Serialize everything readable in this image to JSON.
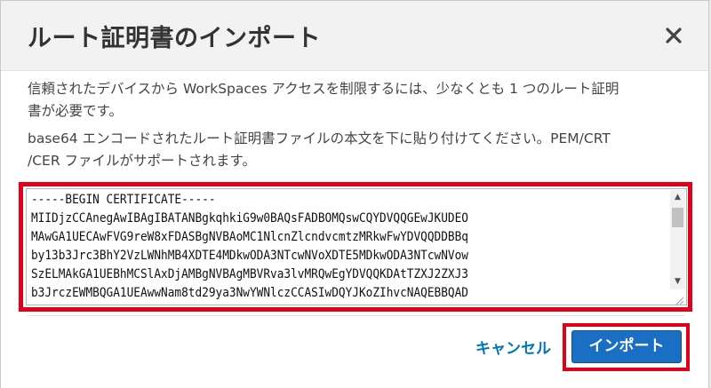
{
  "dialog": {
    "title": "ルート証明書のインポート",
    "close_icon": "close-icon",
    "paragraph1_line1": "信頼されたデバイスから WorkSpaces アクセスを制限するには、少なくとも 1 つのルート証明",
    "paragraph1_line2": "書が必要です。",
    "paragraph2_line1": "base64 エンコードされたルート証明書ファイルの本文を下に貼り付けてください。PEM/CRT",
    "paragraph2_line2": "/CER ファイルがサポートされます。",
    "certificate_text": "-----BEGIN CERTIFICATE-----\nMIIDjzCCAnegAwIBAgIBATANBgkqhkiG9w0BAQsFADBOMQswCQYDVQQGEwJKUDEO\nMAwGA1UECAwFVG9reW8xFDASBgNVBAoMC1NlcnZlcndvcmtzMRkwFwYDVQQDDBBq\nby13b3Jrc3BhY2VzLWNhMB4XDTE4MDkwODA3NTcwNVoXDTE5MDkwODA3NTcwNVow\nSzELMAkGA1UEBhMCSlAxDjAMBgNVBAgMBVRva3lvMRQwEgYDVQQKDAtTZXJ2ZXJ3\nb3JrczEWMBQGA1UEAwwNam8td29ya3NwYWNlczCCASIwDQYJKoZIhvcNAQEBBQAD",
    "cancel_label": "キャンセル",
    "import_label": "インポート"
  },
  "colors": {
    "accent": "#0073bb",
    "primary_button": "#1a6fc5",
    "highlight": "#e0001b"
  }
}
